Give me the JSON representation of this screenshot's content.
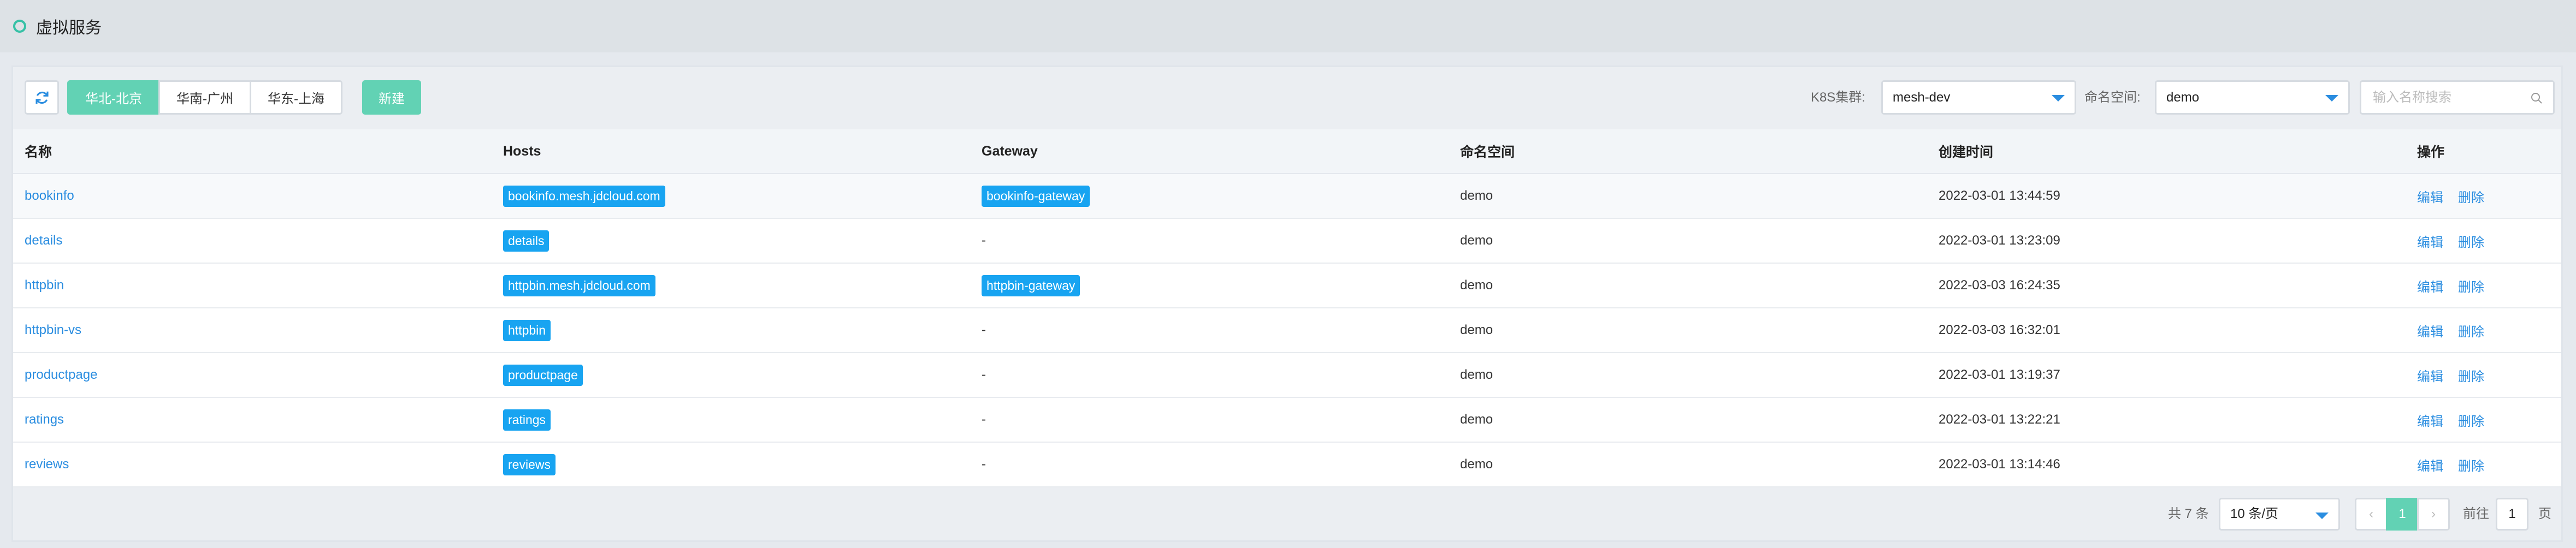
{
  "header": {
    "title": "虚拟服务"
  },
  "toolbar": {
    "regions": [
      "华北-北京",
      "华南-广州",
      "华东-上海"
    ],
    "active_region": 0,
    "new_label": "新建",
    "cluster_label": "K8S集群:",
    "cluster_value": "mesh-dev",
    "namespace_label": "命名空间:",
    "namespace_value": "demo",
    "search_placeholder": "输入名称搜索"
  },
  "table": {
    "columns": [
      "名称",
      "Hosts",
      "Gateway",
      "命名空间",
      "创建时间",
      "操作"
    ],
    "rows": [
      {
        "name": "bookinfo",
        "host": "bookinfo.mesh.jdcloud.com",
        "gateway": "bookinfo-gateway",
        "namespace": "demo",
        "created": "2022-03-01 13:44:59"
      },
      {
        "name": "details",
        "host": "details",
        "gateway": "-",
        "namespace": "demo",
        "created": "2022-03-01 13:23:09"
      },
      {
        "name": "httpbin",
        "host": "httpbin.mesh.jdcloud.com",
        "gateway": "httpbin-gateway",
        "namespace": "demo",
        "created": "2022-03-03 16:24:35"
      },
      {
        "name": "httpbin-vs",
        "host": "httpbin",
        "gateway": "-",
        "namespace": "demo",
        "created": "2022-03-03 16:32:01"
      },
      {
        "name": "productpage",
        "host": "productpage",
        "gateway": "-",
        "namespace": "demo",
        "created": "2022-03-01 13:19:37"
      },
      {
        "name": "ratings",
        "host": "ratings",
        "gateway": "-",
        "namespace": "demo",
        "created": "2022-03-01 13:22:21"
      },
      {
        "name": "reviews",
        "host": "reviews",
        "gateway": "-",
        "namespace": "demo",
        "created": "2022-03-01 13:14:46"
      }
    ],
    "actions": {
      "edit": "编辑",
      "delete": "删除"
    }
  },
  "pager": {
    "total": "共 7 条",
    "page_size": "10 条/页",
    "prev": "‹",
    "current": "1",
    "next": "›",
    "goto_label": "前往",
    "goto_value": "1",
    "page_suffix": "页"
  },
  "colors": {
    "accent": "#62d2b4",
    "link": "#2a8de0",
    "tag": "#18a4f1"
  }
}
